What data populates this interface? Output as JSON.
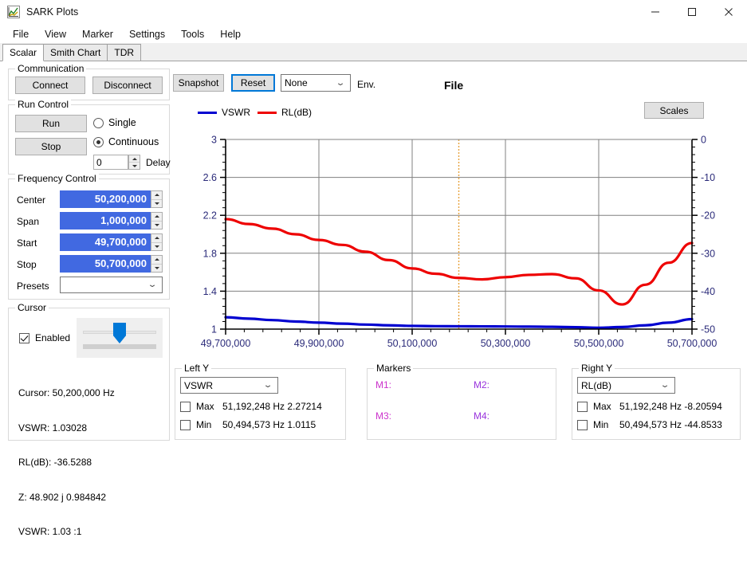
{
  "window": {
    "title": "SARK Plots",
    "icon": "app-plot-icon",
    "minimize": "—",
    "maximize": "☐",
    "close": "✕"
  },
  "menu": [
    "File",
    "View",
    "Marker",
    "Settings",
    "Tools",
    "Help"
  ],
  "tabs": [
    {
      "label": "Scalar",
      "active": true
    },
    {
      "label": "Smith Chart",
      "active": false
    },
    {
      "label": "TDR",
      "active": false
    }
  ],
  "communication": {
    "title": "Communication",
    "connect": "Connect",
    "disconnect": "Disconnect"
  },
  "run_control": {
    "title": "Run Control",
    "run": "Run",
    "stop": "Stop",
    "single": "Single",
    "continuous": "Continuous",
    "single_selected": false,
    "continuous_selected": true,
    "delay_value": "0",
    "delay_label": "Delay"
  },
  "frequency_control": {
    "title": "Frequency Control",
    "rows": [
      {
        "label": "Center",
        "value": "50,200,000"
      },
      {
        "label": "Span",
        "value": "1,000,000"
      },
      {
        "label": "Start",
        "value": "49,700,000"
      },
      {
        "label": "Stop",
        "value": "50,700,000"
      }
    ],
    "presets_label": "Presets",
    "presets_value": ""
  },
  "cursor": {
    "title": "Cursor",
    "enabled_label": "Enabled",
    "enabled": true,
    "slider_percent": 50,
    "readout": [
      "Cursor: 50,200,000 Hz",
      "VSWR: 1.03028",
      "RL(dB): -36.5288",
      "Z: 48.902 j 0.984842",
      "VSWR: 1.03 :1"
    ]
  },
  "toolbar": {
    "snapshot": "Snapshot",
    "reset": "Reset",
    "reset_focused": true,
    "env_select_value": "None",
    "env_label": "Env.",
    "file_title": "File",
    "scales": "Scales"
  },
  "legend": [
    {
      "label": "VSWR",
      "color": "#0000d0"
    },
    {
      "label": "RL(dB)",
      "color": "#ee0000"
    }
  ],
  "left_y_panel": {
    "title": "Left Y",
    "select_value": "VSWR",
    "max_label": "Max",
    "max_checked": false,
    "max_value": "51,192,248 Hz 2.27214",
    "min_label": "Min",
    "min_checked": false,
    "min_value": "50,494,573 Hz 1.0115"
  },
  "markers_panel": {
    "title": "Markers",
    "items": [
      {
        "label": "M1:",
        "value": ""
      },
      {
        "label": "M2:",
        "value": ""
      },
      {
        "label": "M3:",
        "value": ""
      },
      {
        "label": "M4:",
        "value": ""
      }
    ]
  },
  "right_y_panel": {
    "title": "Right Y",
    "select_value": "RL(dB)",
    "max_label": "Max",
    "max_checked": false,
    "max_value": "51,192,248 Hz -8.20594",
    "min_label": "Min",
    "min_checked": false,
    "min_value": "50,494,573 Hz -44.8533"
  },
  "chart_data": {
    "type": "line",
    "title": "File",
    "xlabel": "",
    "ylabel": "VSWR",
    "y2label": "RL(dB)",
    "grid": true,
    "legend_position": "top-left",
    "xlim": [
      49700000,
      50700000
    ],
    "xticks": [
      49700000,
      49900000,
      50100000,
      50300000,
      50500000,
      50700000
    ],
    "xticklabels": [
      "49,700,000",
      "49,900,000",
      "50,100,000",
      "50,300,000",
      "50,500,000",
      "50,700,000"
    ],
    "x_minor_ticks_per_major": 5,
    "ylim": [
      1,
      3
    ],
    "yticks": [
      1,
      1.4,
      1.8,
      2.2,
      2.6,
      3
    ],
    "yticklabels": [
      "1",
      "1.4",
      "1.8",
      "2.2",
      "2.6",
      "3"
    ],
    "y2lim": [
      -50,
      0
    ],
    "y2ticks": [
      -50,
      -40,
      -30,
      -20,
      -10,
      0
    ],
    "y2ticklabels": [
      "-50",
      "-40",
      "-30",
      "-20",
      "-10",
      "0"
    ],
    "cursor_line_x": 50200000,
    "cursor_line_color": "#e8a33d",
    "series": [
      {
        "name": "VSWR",
        "color": "#0000d0",
        "axis": "left",
        "x": [
          49700000,
          49750000,
          49800000,
          49850000,
          49900000,
          49950000,
          50000000,
          50050000,
          50100000,
          50150000,
          50200000,
          50250000,
          50300000,
          50350000,
          50400000,
          50450000,
          50500000,
          50550000,
          50600000,
          50650000,
          50700000
        ],
        "y": [
          1.125,
          1.11,
          1.095,
          1.08,
          1.068,
          1.058,
          1.048,
          1.04,
          1.034,
          1.031,
          1.03,
          1.029,
          1.028,
          1.026,
          1.024,
          1.02,
          1.014,
          1.022,
          1.04,
          1.068,
          1.105
        ]
      },
      {
        "name": "RL(dB)",
        "color": "#ee0000",
        "axis": "right",
        "x": [
          49700000,
          49750000,
          49800000,
          49850000,
          49900000,
          49950000,
          50000000,
          50050000,
          50100000,
          50150000,
          50200000,
          50250000,
          50300000,
          50350000,
          50400000,
          50450000,
          50500000,
          50550000,
          50600000,
          50650000,
          50700000
        ],
        "y": [
          -21.0,
          -22.3,
          -23.5,
          -25.0,
          -26.5,
          -27.8,
          -29.6,
          -31.8,
          -34.0,
          -35.4,
          -36.5,
          -36.9,
          -36.3,
          -35.7,
          -35.5,
          -36.6,
          -39.8,
          -43.5,
          -38.3,
          -32.5,
          -27.3
        ]
      }
    ],
    "readouts": {
      "cursor_frequency_hz": 50200000,
      "cursor_vswr": 1.03028,
      "cursor_rl_db": -36.5288,
      "cursor_impedance": "48.902 j 0.984842",
      "vswr_max": {
        "frequency_hz": 51192248,
        "value": 2.27214
      },
      "vswr_min": {
        "frequency_hz": 50494573,
        "value": 1.0115
      },
      "rl_max": {
        "frequency_hz": 51192248,
        "value": -8.20594
      },
      "rl_min": {
        "frequency_hz": 50494573,
        "value": -44.8533
      }
    }
  }
}
